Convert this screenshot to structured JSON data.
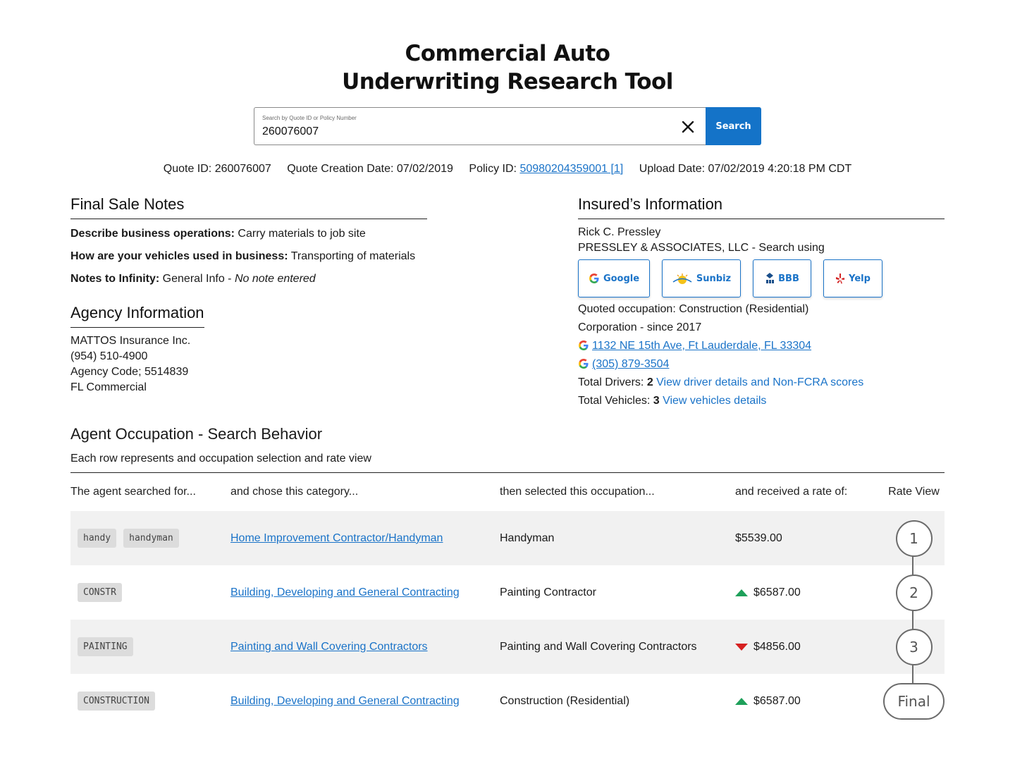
{
  "header": {
    "title_line1": "Commercial Auto",
    "title_line2": "Underwriting Research Tool"
  },
  "search": {
    "label": "Search by Quote ID or Policy Number",
    "value": "260076007",
    "button": "Search"
  },
  "meta": {
    "quote_id": "Quote ID: 260076007",
    "quote_creation": "Quote Creation Date: 07/02/2019",
    "policy_prefix": "Policy ID:",
    "policy_link": "50980204359001 [1]",
    "upload_date": "Upload Date: 07/02/2019 4:20:18 PM CDT"
  },
  "final_sale": {
    "heading": "Final Sale Notes",
    "ops_label": "Describe business operations:",
    "ops_value": "Carry materials to job site",
    "use_label": "How are your vehicles used in business:",
    "use_value": "Transporting of materials",
    "notes_label": "Notes to Infinity:",
    "notes_value": "General Info -",
    "notes_italic": "No note entered"
  },
  "agency": {
    "heading": "Agency Information",
    "name": "MATTOS Insurance Inc.",
    "phone": "(954) 510-4900",
    "code": "Agency Code; 5514839",
    "line": "FL Commercial"
  },
  "insured": {
    "heading": "Insured’s Information",
    "person": "Rick C. Pressley",
    "company": "PRESSLEY & ASSOCIATES, LLC - Search using",
    "buttons": {
      "google": "Google",
      "sunbiz": "Sunbiz",
      "bbb": "BBB",
      "yelp": "Yelp"
    },
    "occupation": "Quoted occupation: Construction (Residential)",
    "corp": "Corporation - since 2017",
    "address": "1132 NE 15th Ave, Ft Lauderdale, FL 33304",
    "phone": "(305) 879-3504",
    "drivers_label": "Total Drivers:",
    "drivers_count": "2",
    "drivers_link": "View driver details and Non-FCRA scores",
    "vehicles_label": "Total Vehicles:",
    "vehicles_count": "3",
    "vehicles_link": "View vehicles details"
  },
  "behavior": {
    "heading": "Agent Occupation - Search Behavior",
    "subtitle": "Each row represents and occupation selection and rate view",
    "columns": [
      "The agent searched for...",
      "and chose this category...",
      "then selected this occupation...",
      "and received a rate of:",
      "Rate View"
    ],
    "rows": [
      {
        "tags": [
          "handy",
          "handyman"
        ],
        "category": "Home Improvement Contractor/Handyman",
        "occupation": "Handyman",
        "rate": "$5539.00",
        "trend": "none",
        "view": "1"
      },
      {
        "tags": [
          "CONSTR"
        ],
        "category": "Building, Developing and General Contracting",
        "occupation": "Painting Contractor",
        "rate": "$6587.00",
        "trend": "up",
        "view": "2"
      },
      {
        "tags": [
          "PAINTING"
        ],
        "category": "Painting and Wall Covering Contractors",
        "occupation": "Painting and Wall Covering Contractors",
        "rate": "$4856.00",
        "trend": "down",
        "view": "3"
      },
      {
        "tags": [
          "CONSTRUCTION"
        ],
        "category": "Building, Developing and General Contracting",
        "occupation": "Construction (Residential)",
        "rate": "$6587.00",
        "trend": "up",
        "view": "Final"
      }
    ]
  },
  "colors": {
    "accent": "#1473c8",
    "link": "#1a73c8",
    "up": "#1ea05a",
    "down": "#d62020",
    "row_shade": "#f1f1f1"
  }
}
